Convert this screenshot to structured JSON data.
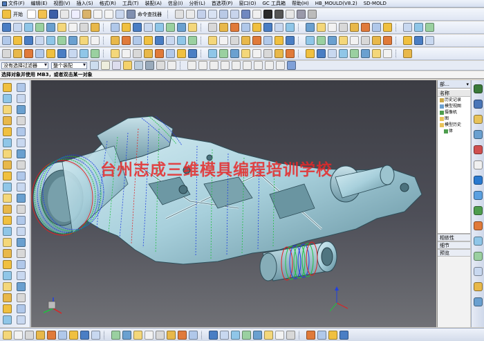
{
  "menu": {
    "items": [
      "文件(F)",
      "编辑(E)",
      "视图(V)",
      "插入(S)",
      "格式(R)",
      "工具(T)",
      "装配(A)",
      "信息(I)",
      "分析(L)",
      "首选项(P)",
      "窗口(O)",
      "GC 工具箱",
      "帮助(H)",
      "HB_MOULD(V8.2)",
      "SD-MOLD"
    ]
  },
  "toolbar": {
    "start_label": "开始",
    "command_finder_label": "命令查找器"
  },
  "filter": {
    "type_filter_value": "没有选择过滤器",
    "assembly_filter_value": "整个装配"
  },
  "cue_line": "选择对象并使用 MB3，或者双击某一对象",
  "viewport": {
    "watermark": "台州志成三维模具编程培训学校"
  },
  "navigator": {
    "title": "部…",
    "column_name": "名称",
    "nodes": [
      "历史记录",
      "模型视图",
      "摄像机",
      "图",
      "模型历史",
      "体"
    ],
    "sections": [
      "相依性",
      "细节",
      "预览"
    ]
  },
  "colors": {
    "part_surface": "#a8d0dc",
    "toolpath_red": "#e02020",
    "toolpath_green": "#20c040",
    "toolpath_blue": "#2040e0",
    "watermark": "#e62828"
  }
}
